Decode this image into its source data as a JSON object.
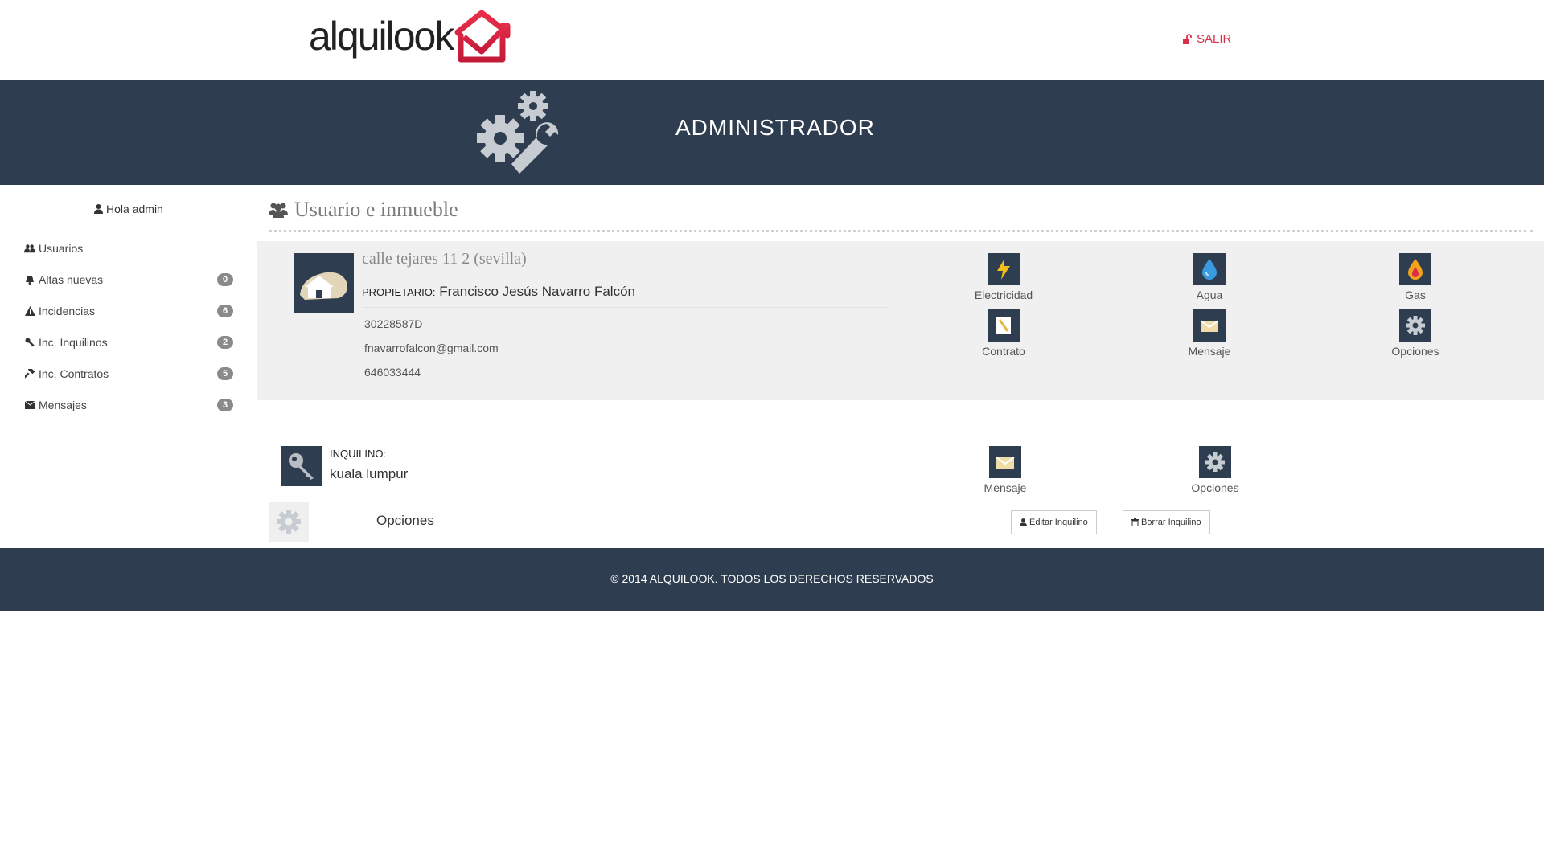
{
  "header": {
    "logo_text": "alquilook",
    "logout_label": "SALIR",
    "brand_color": "#d9304a"
  },
  "banner": {
    "title": "ADMINISTRADOR",
    "background": "#2e3e50"
  },
  "sidebar": {
    "greeting": "Hola admin",
    "items": [
      {
        "label": "Usuarios",
        "icon": "users-icon",
        "badge": null
      },
      {
        "label": "Altas nuevas",
        "icon": "bell-icon",
        "badge": "0"
      },
      {
        "label": "Incidencias",
        "icon": "warning-icon",
        "badge": "6"
      },
      {
        "label": "Inc. Inquilinos",
        "icon": "wrench-icon",
        "badge": "2"
      },
      {
        "label": "Inc. Contratos",
        "icon": "hammer-icon",
        "badge": "5"
      },
      {
        "label": "Mensajes",
        "icon": "envelope-icon",
        "badge": "3"
      }
    ]
  },
  "main": {
    "section_title": "Usuario e inmueble",
    "property": {
      "address": "calle tejares 11 2 (sevilla)",
      "owner_label": "PROPIETARIO:",
      "owner_name": "Francisco Jesús Navarro Falcón",
      "dni": "30228587D",
      "email": "fnavarrofalcon@gmail.com",
      "phone": "646033444"
    },
    "services": [
      {
        "label": "Electricidad",
        "icon": "lightning-icon"
      },
      {
        "label": "Agua",
        "icon": "water-drop-icon"
      },
      {
        "label": "Gas",
        "icon": "flame-icon"
      },
      {
        "label": "Contrato",
        "icon": "contract-icon"
      },
      {
        "label": "Mensaje",
        "icon": "envelope-icon"
      },
      {
        "label": "Opciones",
        "icon": "gear-icon"
      }
    ],
    "tenant": {
      "label": "INQUILINO:",
      "name": "kuala lumpur",
      "actions": [
        {
          "label": "Mensaje",
          "icon": "envelope-icon"
        },
        {
          "label": "Opciones",
          "icon": "gear-icon"
        }
      ]
    },
    "options_row": {
      "label": "Opciones",
      "edit_button": "Editar Inquilino",
      "delete_button": "Borrar Inquilino"
    }
  },
  "footer": {
    "text": "© 2014 ALQUILOOK. TODOS LOS DERECHOS RESERVADOS"
  }
}
